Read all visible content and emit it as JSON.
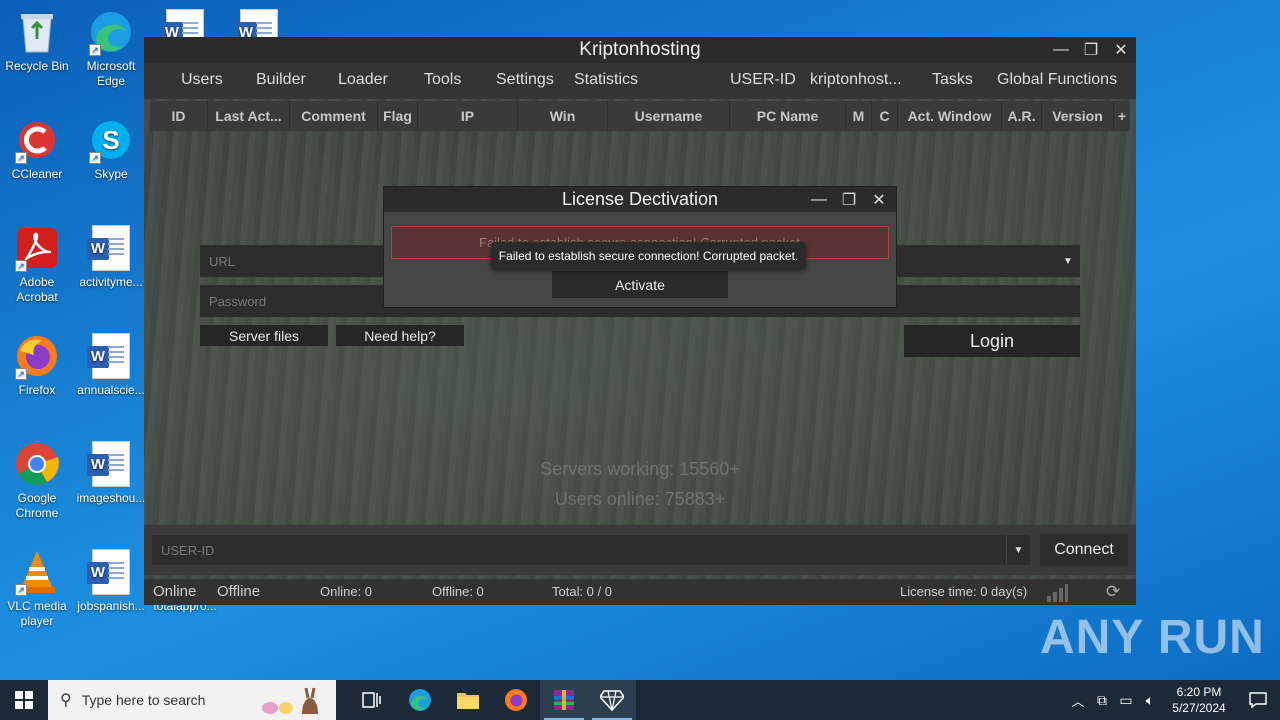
{
  "desktop": {
    "icons": [
      {
        "label": "Recycle Bin"
      },
      {
        "label": "Microsoft Edge"
      },
      {
        "label": "CCleaner"
      },
      {
        "label": "Skype"
      },
      {
        "label": "Adobe Acrobat"
      },
      {
        "label": "activityme..."
      },
      {
        "label": "Firefox"
      },
      {
        "label": "annualscie..."
      },
      {
        "label": "Google Chrome"
      },
      {
        "label": "imageshou..."
      },
      {
        "label": "VLC media player"
      },
      {
        "label": "jobspanish..."
      },
      {
        "label": "totalappro..."
      }
    ]
  },
  "app": {
    "title": "Kriptonhosting",
    "menu": [
      "Users",
      "Builder",
      "Loader",
      "Tools",
      "Settings",
      "Statistics",
      "USER-ID",
      "kriptonhost...",
      "Tasks",
      "Global Functions"
    ],
    "columns": [
      "ID",
      "Last Act...",
      "Comment",
      "Flag",
      "IP",
      "Win",
      "Username",
      "PC Name",
      "M",
      "C",
      "Act. Window",
      "A.R.",
      "Version",
      "+"
    ],
    "url_placeholder": "URL",
    "password_placeholder": "Password",
    "server_files": "Server files",
    "need_help": "Need help?",
    "login": "Login",
    "servers_working": "Servers working: 15560+",
    "users_online": "Users online: 75883+",
    "userid_placeholder": "USER-ID",
    "connect": "Connect",
    "status": {
      "online_tab": "Online",
      "offline_tab": "Offline",
      "online_count": "Online: 0",
      "offline_count": "Offline: 0",
      "total": "Total: 0 / 0",
      "license_time": "License time: 0 day(s)"
    }
  },
  "dialog": {
    "title": "License Dectivation",
    "input_value": "Failed to establish secure connection! Corrupted packet.",
    "activate": "Activate",
    "tooltip": "Failed to establish secure connection! Corrupted packet."
  },
  "taskbar": {
    "search_placeholder": "Type here to search",
    "time": "6:20 PM",
    "date": "5/27/2024"
  },
  "watermark": "ANY RUN",
  "colors": {
    "accent_error": "#b23b3b",
    "window_bg": "#3c3c3c",
    "taskbar": "#1c2a38"
  }
}
